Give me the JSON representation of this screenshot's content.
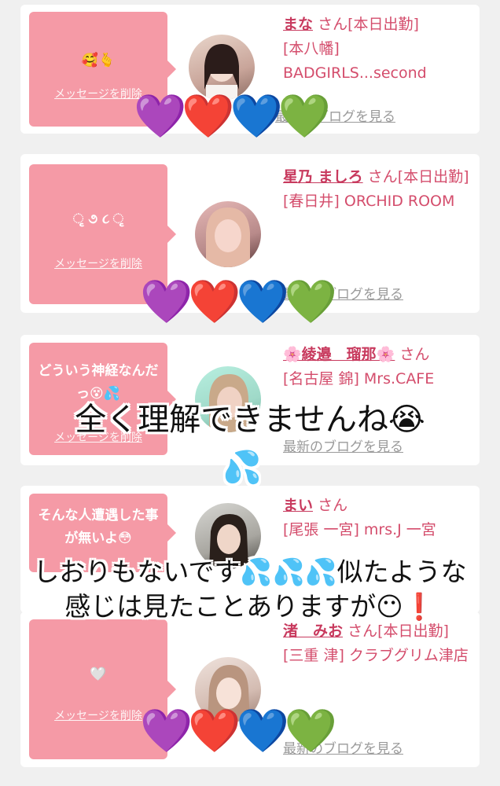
{
  "delete_label": "メッセージを削除",
  "blog_label": "最新のブログを見る",
  "san": "さん",
  "cards": [
    {
      "message": "🥰🫰",
      "name": "まな",
      "rest": "[本日出勤]",
      "location": "[本八幡] BADGIRLS...second",
      "heart_colors": [
        "#a040e0",
        "#e01010",
        "#1060e0",
        "#10b010"
      ],
      "heart_icons": [
        "purple-heart-icon",
        "red-heart-icon",
        "blue-heart-icon",
        "green-heart-icon"
      ]
    },
    {
      "message": "ૃ ૭ ૮ ૃ",
      "name": "星乃 ましろ",
      "rest": "[本日出勤]",
      "location": "[春日井] ORCHID ROOM"
    },
    {
      "message": "どういう神経なんだっ😵💦",
      "name": "🌸綾邉　瑠那🌸",
      "rest": "",
      "location": "[名古屋 錦] Mrs.CAFE"
    },
    {
      "message": "そんな人遭遇した事が無いよ😳",
      "name": "まい",
      "rest": "",
      "location": "[尾張 一宮] mrs.J 一宮"
    },
    {
      "message": "🤍",
      "name": "渚　みお",
      "rest": "[本日出勤]",
      "location": "[三重 津] クラブグリム津店"
    }
  ],
  "hearts_text": "💜❤️💙💚",
  "overlay": {
    "line1": "全く理解できませんね😭",
    "line1_drop": "💦",
    "line2": "しおりもないです💦💦💦似たような",
    "line3": "感じは見たことありますが😶❗"
  }
}
